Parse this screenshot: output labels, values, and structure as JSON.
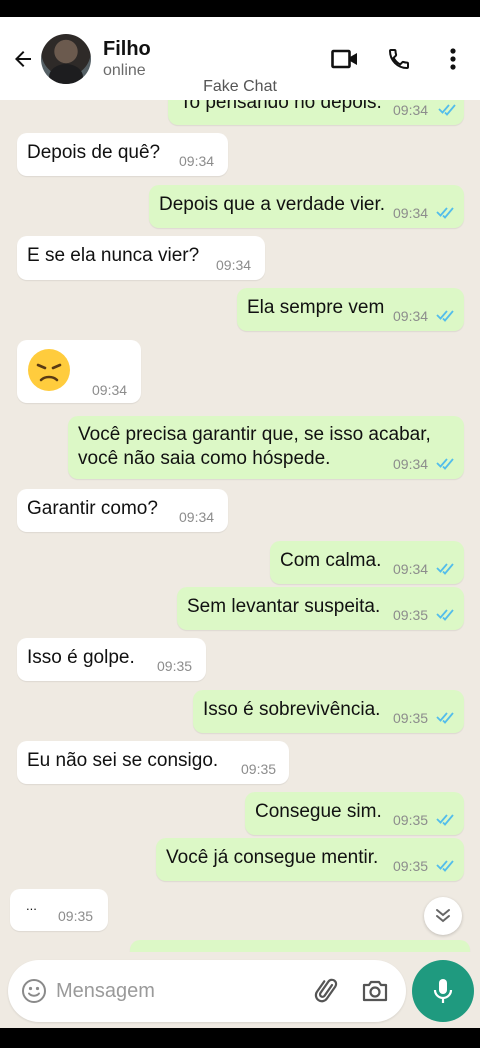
{
  "header": {
    "contact_name": "Filho",
    "status": "online",
    "watermark": "Fake Chat"
  },
  "messages": [
    {
      "dir": "out",
      "text": "To pensando no depois.",
      "time": "09:34",
      "read": true
    },
    {
      "dir": "in",
      "text": "Depois de quê?",
      "time": "09:34"
    },
    {
      "dir": "out",
      "text": "Depois que a verdade vier.",
      "time": "09:34",
      "read": true
    },
    {
      "dir": "in",
      "text": "E se ela nunca vier?",
      "time": "09:34"
    },
    {
      "dir": "out",
      "text": "Ela sempre vem",
      "time": "09:34",
      "read": true
    },
    {
      "dir": "in",
      "text": "😞",
      "time": "09:34"
    },
    {
      "dir": "out",
      "text_line1": "Você precisa garantir que, se isso acabar,",
      "text_line2": "você não saia como hóspede.",
      "time": "09:34",
      "read": true
    },
    {
      "dir": "in",
      "text": "Garantir como?",
      "time": "09:34"
    },
    {
      "dir": "out",
      "text": "Com calma.",
      "time": "09:34",
      "read": true
    },
    {
      "dir": "out",
      "text": "Sem levantar suspeita.",
      "time": "09:35",
      "read": true
    },
    {
      "dir": "in",
      "text": "Isso é golpe.",
      "time": "09:35"
    },
    {
      "dir": "out",
      "text": "Isso é sobrevivência.",
      "time": "09:35",
      "read": true
    },
    {
      "dir": "in",
      "text": "Eu não sei se consigo.",
      "time": "09:35"
    },
    {
      "dir": "out",
      "text": "Consegue sim.",
      "time": "09:35",
      "read": true
    },
    {
      "dir": "out",
      "text": "Você já consegue mentir.",
      "time": "09:35",
      "read": true
    },
    {
      "dir": "in",
      "text": "...",
      "time": "09:35"
    }
  ],
  "composer": {
    "placeholder": "Mensagem"
  },
  "colors": {
    "outgoing_bubble": "#dcf8c6",
    "incoming_bubble": "#ffffff",
    "chat_background": "#efeae2",
    "accent": "#1f9a7f",
    "read_ticks": "#53bdeb"
  }
}
